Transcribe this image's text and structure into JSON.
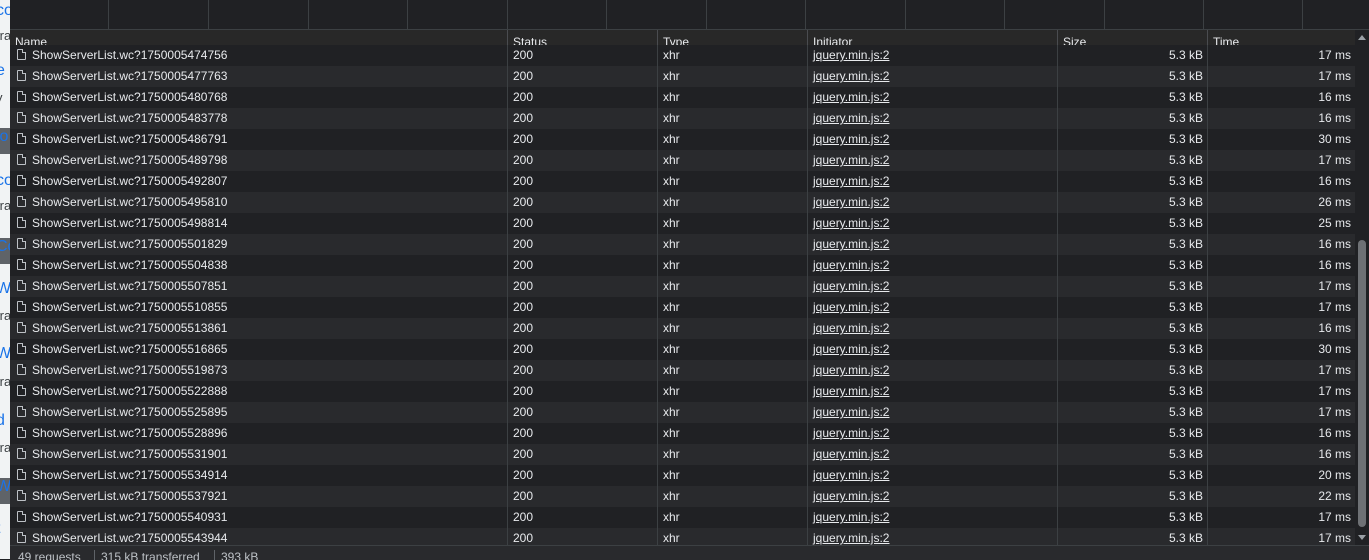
{
  "page_peek": {
    "fragments": [
      "co",
      "tra",
      "e",
      "y",
      "lo",
      "co",
      "tra",
      "Co",
      "W",
      "tra",
      "W",
      "tra",
      "d",
      "tra",
      "W",
      "t"
    ]
  },
  "columns": {
    "name": "Name",
    "status": "Status",
    "type": "Type",
    "initiator": "Initiator",
    "size": "Size",
    "time": "Time"
  },
  "partial_row": {
    "name": "ShowServerList.wc?1750005474756",
    "status": "200",
    "type": "xhr",
    "initiator": "jquery.min.js:2",
    "size": "5.3 kB",
    "time": "17 ms"
  },
  "rows": [
    {
      "name": "ShowServerList.wc?1750005477763",
      "status": "200",
      "type": "xhr",
      "initiator": "jquery.min.js:2",
      "size": "5.3 kB",
      "time": "17 ms"
    },
    {
      "name": "ShowServerList.wc?1750005480768",
      "status": "200",
      "type": "xhr",
      "initiator": "jquery.min.js:2",
      "size": "5.3 kB",
      "time": "16 ms"
    },
    {
      "name": "ShowServerList.wc?1750005483778",
      "status": "200",
      "type": "xhr",
      "initiator": "jquery.min.js:2",
      "size": "5.3 kB",
      "time": "16 ms"
    },
    {
      "name": "ShowServerList.wc?1750005486791",
      "status": "200",
      "type": "xhr",
      "initiator": "jquery.min.js:2",
      "size": "5.3 kB",
      "time": "30 ms"
    },
    {
      "name": "ShowServerList.wc?1750005489798",
      "status": "200",
      "type": "xhr",
      "initiator": "jquery.min.js:2",
      "size": "5.3 kB",
      "time": "17 ms"
    },
    {
      "name": "ShowServerList.wc?1750005492807",
      "status": "200",
      "type": "xhr",
      "initiator": "jquery.min.js:2",
      "size": "5.3 kB",
      "time": "16 ms"
    },
    {
      "name": "ShowServerList.wc?1750005495810",
      "status": "200",
      "type": "xhr",
      "initiator": "jquery.min.js:2",
      "size": "5.3 kB",
      "time": "26 ms"
    },
    {
      "name": "ShowServerList.wc?1750005498814",
      "status": "200",
      "type": "xhr",
      "initiator": "jquery.min.js:2",
      "size": "5.3 kB",
      "time": "25 ms"
    },
    {
      "name": "ShowServerList.wc?1750005501829",
      "status": "200",
      "type": "xhr",
      "initiator": "jquery.min.js:2",
      "size": "5.3 kB",
      "time": "16 ms"
    },
    {
      "name": "ShowServerList.wc?1750005504838",
      "status": "200",
      "type": "xhr",
      "initiator": "jquery.min.js:2",
      "size": "5.3 kB",
      "time": "16 ms"
    },
    {
      "name": "ShowServerList.wc?1750005507851",
      "status": "200",
      "type": "xhr",
      "initiator": "jquery.min.js:2",
      "size": "5.3 kB",
      "time": "17 ms"
    },
    {
      "name": "ShowServerList.wc?1750005510855",
      "status": "200",
      "type": "xhr",
      "initiator": "jquery.min.js:2",
      "size": "5.3 kB",
      "time": "17 ms"
    },
    {
      "name": "ShowServerList.wc?1750005513861",
      "status": "200",
      "type": "xhr",
      "initiator": "jquery.min.js:2",
      "size": "5.3 kB",
      "time": "16 ms"
    },
    {
      "name": "ShowServerList.wc?1750005516865",
      "status": "200",
      "type": "xhr",
      "initiator": "jquery.min.js:2",
      "size": "5.3 kB",
      "time": "30 ms"
    },
    {
      "name": "ShowServerList.wc?1750005519873",
      "status": "200",
      "type": "xhr",
      "initiator": "jquery.min.js:2",
      "size": "5.3 kB",
      "time": "17 ms"
    },
    {
      "name": "ShowServerList.wc?1750005522888",
      "status": "200",
      "type": "xhr",
      "initiator": "jquery.min.js:2",
      "size": "5.3 kB",
      "time": "17 ms"
    },
    {
      "name": "ShowServerList.wc?1750005525895",
      "status": "200",
      "type": "xhr",
      "initiator": "jquery.min.js:2",
      "size": "5.3 kB",
      "time": "17 ms"
    },
    {
      "name": "ShowServerList.wc?1750005528896",
      "status": "200",
      "type": "xhr",
      "initiator": "jquery.min.js:2",
      "size": "5.3 kB",
      "time": "16 ms"
    },
    {
      "name": "ShowServerList.wc?1750005531901",
      "status": "200",
      "type": "xhr",
      "initiator": "jquery.min.js:2",
      "size": "5.3 kB",
      "time": "16 ms"
    },
    {
      "name": "ShowServerList.wc?1750005534914",
      "status": "200",
      "type": "xhr",
      "initiator": "jquery.min.js:2",
      "size": "5.3 kB",
      "time": "20 ms"
    },
    {
      "name": "ShowServerList.wc?1750005537921",
      "status": "200",
      "type": "xhr",
      "initiator": "jquery.min.js:2",
      "size": "5.3 kB",
      "time": "22 ms"
    },
    {
      "name": "ShowServerList.wc?1750005540931",
      "status": "200",
      "type": "xhr",
      "initiator": "jquery.min.js:2",
      "size": "5.3 kB",
      "time": "17 ms"
    },
    {
      "name": "ShowServerList.wc?1750005543944",
      "status": "200",
      "type": "xhr",
      "initiator": "jquery.min.js:2",
      "size": "5.3 kB",
      "time": "17 ms"
    }
  ],
  "status_bar": {
    "requests": "49 requests",
    "transferred": "315 kB transferred",
    "resources": "393 kB"
  }
}
